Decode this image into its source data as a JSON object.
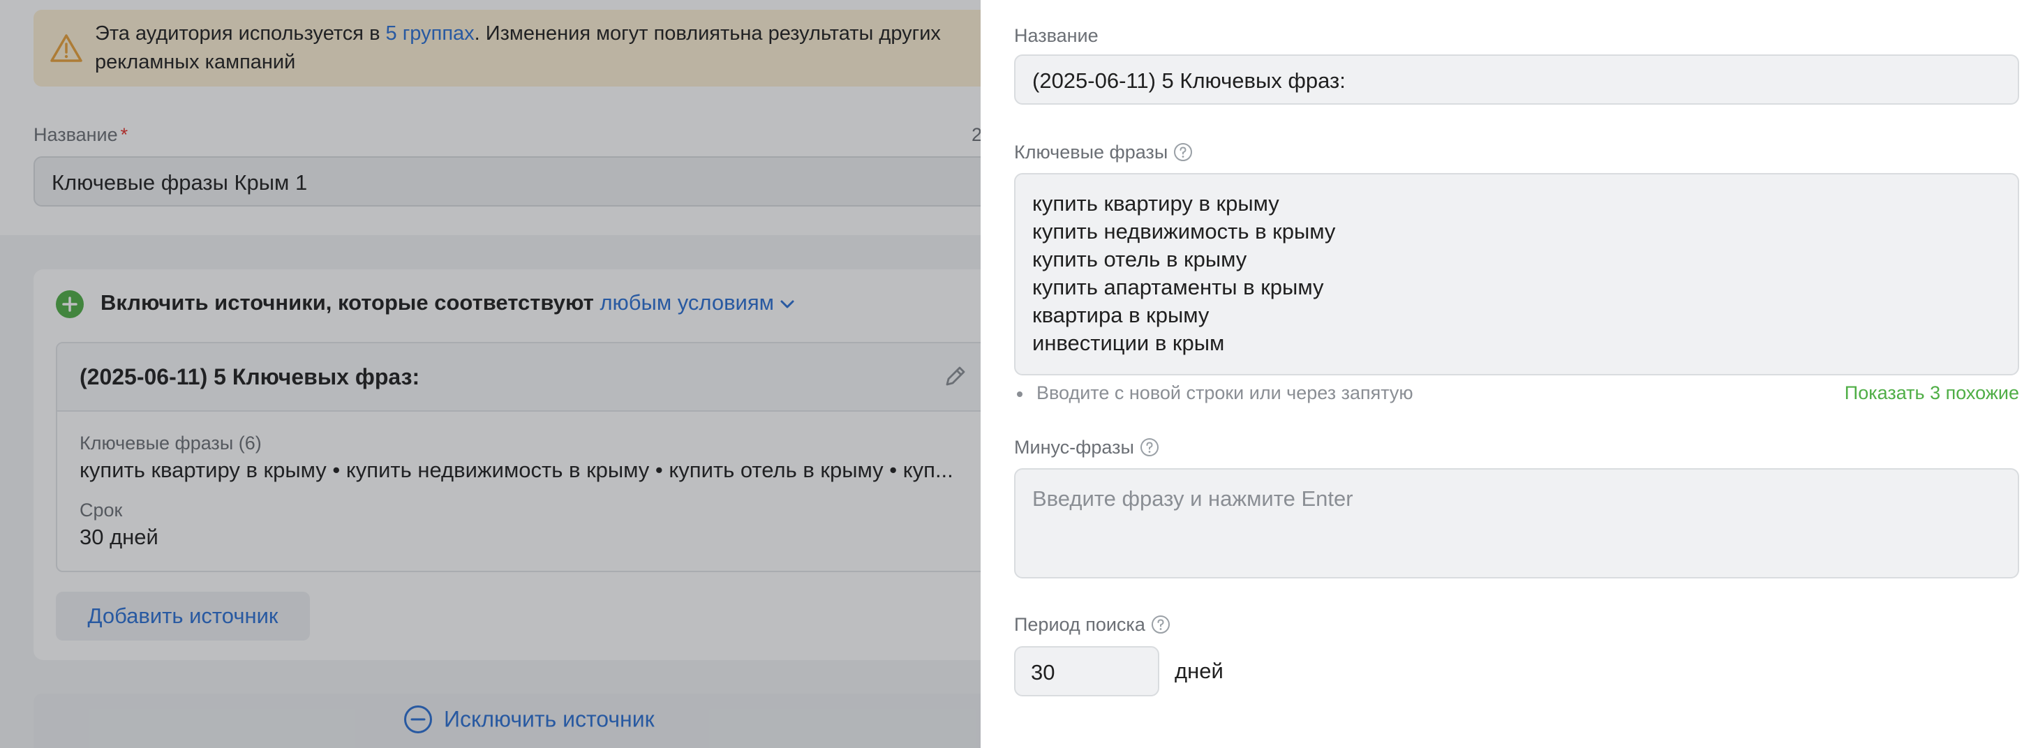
{
  "background": {
    "warning": {
      "text_before": "Эта аудитория используется в ",
      "link": "5 группах",
      "text_after": ". Изменения могут повлиятьна результаты других рекламных кампаний",
      "icon": "warning-triangle-icon"
    },
    "name_label": "Название",
    "required_mark": "*",
    "counter": "2",
    "name_value": "Ключевые фразы Крым 1",
    "rule": {
      "prefix": "Включить источники, которые соответствуют ",
      "condition_link": "любым условиям",
      "icon": "plus-circle-icon"
    },
    "source": {
      "title": "(2025-06-11) 5 Ключевых фраз:",
      "keywords_label": "Ключевые фразы (6)",
      "keywords_preview": "купить квартиру в крыму • купить недвижимость в крыму • купить отель в крыму • куп...",
      "term_label": "Срок",
      "term_value": "30 дней"
    },
    "add_source_button": "Добавить источник",
    "exclude_button": "Исключить источник"
  },
  "panel": {
    "name_label": "Название",
    "name_value": "(2025-06-11) 5 Ключевых фраз:",
    "keywords_label": "Ключевые фразы",
    "keywords": [
      "купить квартиру в крыму",
      "купить недвижимость в крыму",
      "купить отель в крыму",
      "купить апартаменты в крыму",
      "квартира в крыму",
      "инвестиции в крым"
    ],
    "keywords_hint": "Вводите с новой строки или через запятую",
    "show_similar": "Показать 3 похожие",
    "minus_label": "Минус-фразы",
    "minus_placeholder": "Введите фразу и нажмите Enter",
    "period_label": "Период поиска",
    "period_value": "30",
    "period_unit": "дней"
  },
  "colors": {
    "accent_link": "#2a6fd3",
    "success_green": "#4fae46",
    "warning_bg": "#fdefd4",
    "warning_icon": "#e8a13a"
  }
}
